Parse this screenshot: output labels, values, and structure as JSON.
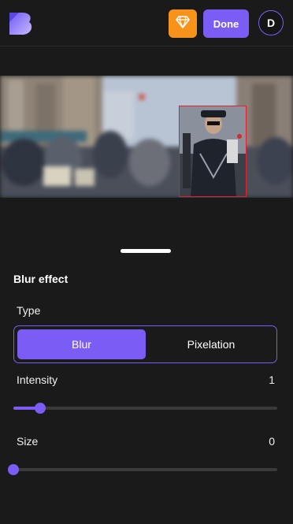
{
  "header": {
    "logo_icon": "logo-b-icon",
    "premium_icon": "diamond-icon",
    "done_label": "Done",
    "avatar_initial": "D",
    "colors": {
      "accent": "#7b5cf5",
      "premium": "#f7931a"
    }
  },
  "panel": {
    "title": "Blur effect",
    "type_label": "Type",
    "type_options": [
      "Blur",
      "Pixelation"
    ],
    "type_selected": "Blur",
    "intensity": {
      "label": "Intensity",
      "value": "1",
      "fraction": 0.1
    },
    "size": {
      "label": "Size",
      "value": "0",
      "fraction": 0.0
    }
  },
  "canvas": {
    "selection_color": "#e0202a"
  }
}
